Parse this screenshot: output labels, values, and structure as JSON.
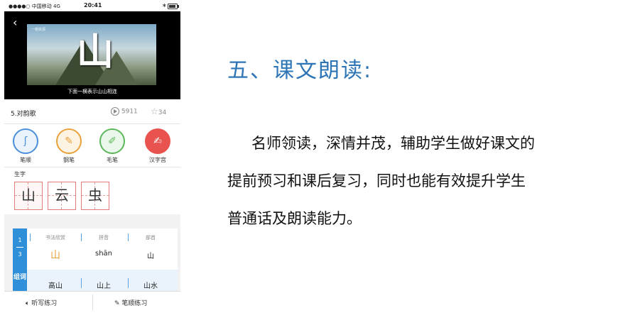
{
  "status_bar": {
    "carrier": "●●●●○ 中国移动  4G",
    "time": "20:41"
  },
  "video": {
    "back_icon": "chevron-left-icon",
    "logo": "一朝资源",
    "big_character": "山",
    "caption": "下面一横表示山山相连"
  },
  "lesson": {
    "title": "5.对韵歌",
    "plays": "5911",
    "stars": "34"
  },
  "tools": [
    {
      "label": "笔顺",
      "icon": "stroke-order-icon",
      "color": "#4a90d9"
    },
    {
      "label": "钢笔",
      "icon": "pen-icon",
      "color": "#e8a23a"
    },
    {
      "label": "毛笔",
      "icon": "brush-icon",
      "color": "#5cb85c"
    },
    {
      "label": "汉字宫",
      "icon": "hanzi-palace-icon",
      "color": "#e8534f"
    }
  ],
  "shengzi": {
    "label": "生字",
    "chars": [
      "山",
      "云",
      "虫"
    ]
  },
  "detail": {
    "page_current": "1",
    "page_total": "3",
    "headers": [
      "书法欣赏",
      "拼音",
      "部首"
    ],
    "values": [
      "山",
      "shān",
      "山"
    ],
    "zuci_label": "组词",
    "words": [
      "高山",
      "山上",
      "山水"
    ]
  },
  "bottom_bar": {
    "dictation": "听写练习",
    "stroke_practice": "笔顺练习"
  },
  "slide": {
    "heading": "五、课文朗读:",
    "lines": [
      "名师领读，深情并茂，辅助学生做好课文的",
      "提前预习和课后复习，同时也能有效提升学生",
      "普通话及朗读能力。"
    ]
  }
}
